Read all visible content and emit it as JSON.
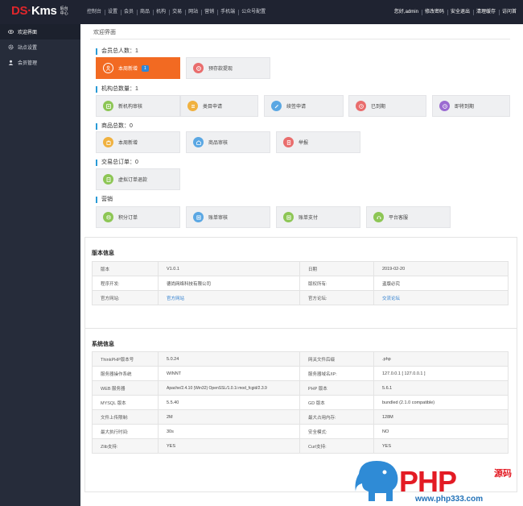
{
  "logo": {
    "brand_ds": "DS",
    "brand_dot": "·",
    "brand_kms": "Kms",
    "sub": "后台中心"
  },
  "nav": {
    "items": [
      "控制台",
      "设置",
      "会员",
      "商品",
      "机构",
      "交易",
      "网站",
      "营销",
      "手机端",
      "公众号配置"
    ],
    "right": [
      "您好,admin",
      "修改密码",
      "安全退出",
      "清理缓存",
      "访问首"
    ]
  },
  "sidebar": {
    "items": [
      {
        "label": "欢迎界面",
        "icon": "eye-icon"
      },
      {
        "label": "站点设置",
        "icon": "gear-icon"
      },
      {
        "label": "会员管理",
        "icon": "user-icon"
      }
    ]
  },
  "breadcrumb": "欢迎界面",
  "sections": {
    "members": {
      "title": "会员总人数：1",
      "tiles": [
        {
          "label": "本周新增",
          "badge": "1",
          "icon": "person-icon"
        },
        {
          "label": "预存款提现",
          "icon": "money-icon"
        }
      ]
    },
    "orgs": {
      "title": "机构总数量：1",
      "tiles": [
        {
          "label": "新机构审核",
          "icon": "list-icon"
        },
        {
          "label": "类目申请",
          "icon": "menu-icon"
        },
        {
          "label": "续签申请",
          "icon": "pen-icon"
        },
        {
          "label": "已到期",
          "icon": "expired-icon"
        },
        {
          "label": "即将到期",
          "icon": "clock-icon"
        }
      ]
    },
    "goods": {
      "title": "商品总数：0",
      "tiles": [
        {
          "label": "本周新增",
          "icon": "bag-icon"
        },
        {
          "label": "商品审核",
          "icon": "shop-icon"
        },
        {
          "label": "举报",
          "icon": "report-icon"
        }
      ]
    },
    "orders": {
      "title": "交易总订单：0",
      "tiles": [
        {
          "label": "虚拟订单退款",
          "icon": "refund-icon"
        }
      ]
    },
    "marketing": {
      "title": "营销",
      "tiles": [
        {
          "label": "积分订单",
          "icon": "coins-icon"
        },
        {
          "label": "账单审核",
          "icon": "bill-icon"
        },
        {
          "label": "账单支付",
          "icon": "pay-icon"
        },
        {
          "label": "平台客服",
          "icon": "service-icon"
        }
      ]
    }
  },
  "version_panel": {
    "title": "版本信息",
    "rows": [
      [
        "版本",
        "V1.0.1",
        "日期",
        "2019-02-20"
      ],
      [
        "程序开发:",
        "德尚网络科技有限公司",
        "版权所有:",
        "盗版必究"
      ],
      [
        "官方网站:",
        "官方网站",
        "官方论坛:",
        "交流论坛"
      ]
    ]
  },
  "system_panel": {
    "title": "系统信息",
    "rows": [
      [
        "ThinkPHP版本号",
        "5.0.24",
        "网关文件后缀",
        ".php"
      ],
      [
        "服务器操作系统",
        "WINNT",
        "服务器域名/IP:",
        "127.0.0.1 [ 127.0.0.1 ]"
      ],
      [
        "WEB 服务器",
        "Apache/2.4.10 (Win32) OpenSSL/1.0.1i mod_fcgid/2.3.9",
        "PHP 版本",
        "5.6.1"
      ],
      [
        "MYSQL 版本",
        "5.5.40",
        "GD 版本",
        "bundled (2.1.0 compatible)"
      ],
      [
        "文件上传限制:",
        "2M",
        "最大占用内存:",
        "128M"
      ],
      [
        "最大执行时间:",
        "30s",
        "安全模式:",
        "NO"
      ],
      [
        "Zlib支持:",
        "YES",
        "Curl支持:",
        "YES"
      ]
    ]
  },
  "watermark": {
    "text": "PHP",
    "cn": "源码",
    "url": "www.php333.com"
  },
  "colors": {
    "accent": "#2a9bd6",
    "highlight": "#f26a22",
    "topbar": "#1f2331",
    "sidebar": "#262c3a"
  }
}
